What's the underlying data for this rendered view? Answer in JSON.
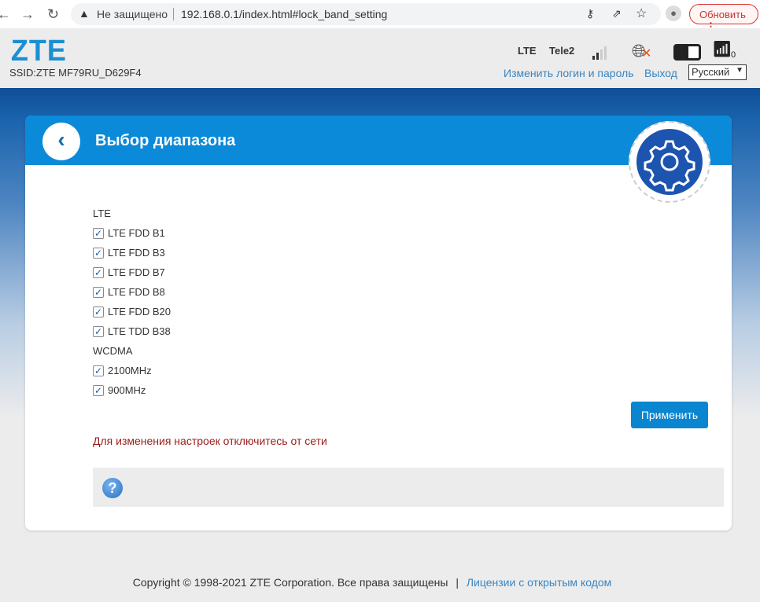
{
  "browser": {
    "insecure_label": "Не защищено",
    "url": "192.168.0.1/index.html#lock_band_setting",
    "update_label": "Обновить"
  },
  "header": {
    "logo": "ZTE",
    "ssid": "SSID:ZTE MF79RU_D629F4",
    "network_type": "LTE",
    "operator": "Tele2",
    "wifi_clients": "0",
    "change_login_link": "Изменить логин и пароль",
    "logout_link": "Выход",
    "language": "Русский"
  },
  "page": {
    "title": "Выбор диапазона",
    "groups": [
      {
        "label": "LTE",
        "bands": [
          {
            "label": "LTE FDD B1",
            "checked": true
          },
          {
            "label": "LTE FDD B3",
            "checked": true
          },
          {
            "label": "LTE FDD B7",
            "checked": true
          },
          {
            "label": "LTE FDD B8",
            "checked": true
          },
          {
            "label": "LTE FDD B20",
            "checked": true
          },
          {
            "label": "LTE TDD B38",
            "checked": true
          }
        ]
      },
      {
        "label": "WCDMA",
        "bands": [
          {
            "label": "2100MHz",
            "checked": true
          },
          {
            "label": "900MHz",
            "checked": true
          }
        ]
      }
    ],
    "apply_label": "Применить",
    "warning": "Для изменения настроек отключитесь от сети"
  },
  "footer": {
    "copyright": "Copyright © 1998-2021 ZTE Corporation. Все права защищены",
    "separator": "|",
    "license_link": "Лицензии с открытым кодом"
  }
}
